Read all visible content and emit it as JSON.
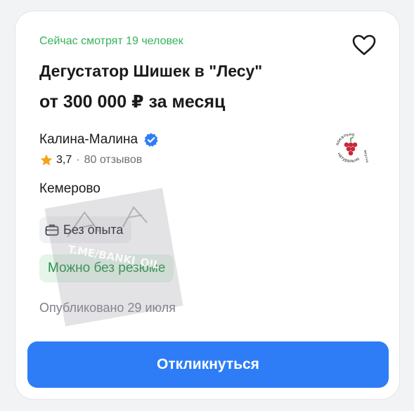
{
  "card": {
    "watchers_text": "Сейчас смотрят 19 человек",
    "title": "Дегустатор Шишек в \"Лесу\"",
    "salary": "от 300 000 ₽ за месяц",
    "company": "Калина-Малина",
    "rating_value": "3,7",
    "rating_separator": "·",
    "reviews": "80 отзывов",
    "logo_text_top": "локально",
    "logo_text_right": "вкусно",
    "logo_text_bottom": "натурально",
    "city": "Кемерово",
    "experience": "Без опыта",
    "resume": "Можно без резюме",
    "published": "Опубликовано 29 июля",
    "apply_label": "Откликнуться",
    "watermark_text": "T.ME/BANKI_OIL"
  },
  "icons": {
    "favorite": "heart-outline-icon",
    "verified": "verified-check-icon",
    "star": "star-icon",
    "experience": "briefcase-icon"
  },
  "colors": {
    "accent": "#2e7df6",
    "watchers": "#34b15a",
    "resume_text": "#1f8f44",
    "resume_bg": "#e5f5e9",
    "star": "#f7a21b",
    "logo": "#c8283c"
  }
}
